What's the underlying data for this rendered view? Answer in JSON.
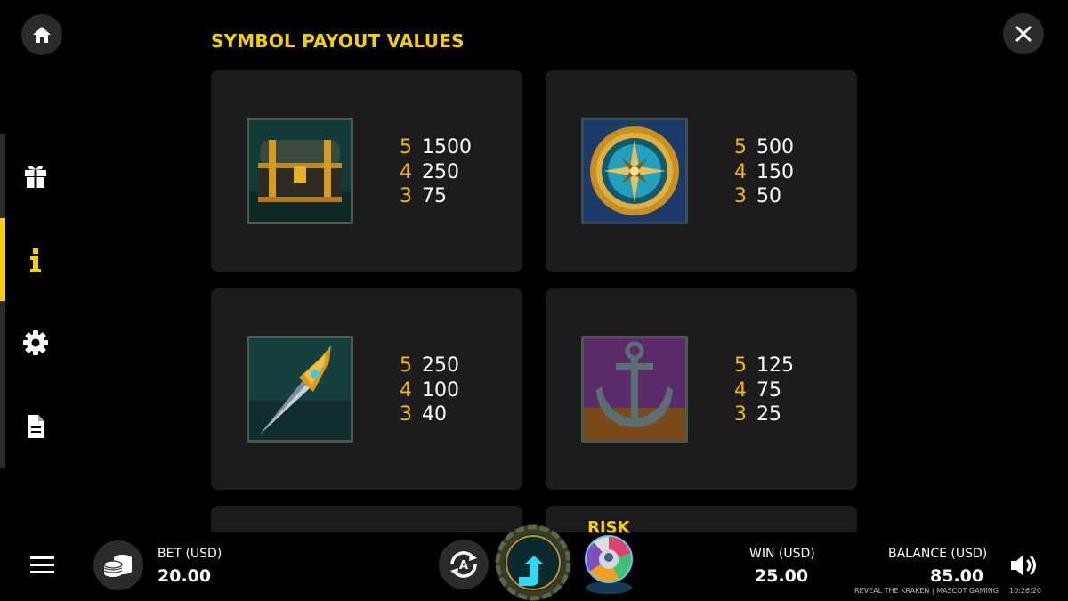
{
  "header": {
    "title": "SYMBOL PAYOUT VALUES",
    "home_icon": "home-icon",
    "close_icon": "close-icon"
  },
  "sidebar": {
    "items": [
      {
        "icon": "gift-icon",
        "active": false
      },
      {
        "icon": "info-icon",
        "active": true
      },
      {
        "icon": "gear-icon",
        "active": false
      },
      {
        "icon": "document-icon",
        "active": false
      }
    ],
    "active_color": "#f5d000"
  },
  "paytable": [
    {
      "symbol": "treasure-chest",
      "pays": [
        {
          "count": "5",
          "value": "1500"
        },
        {
          "count": "4",
          "value": "250"
        },
        {
          "count": "3",
          "value": "75"
        }
      ]
    },
    {
      "symbol": "compass",
      "pays": [
        {
          "count": "5",
          "value": "500"
        },
        {
          "count": "4",
          "value": "150"
        },
        {
          "count": "3",
          "value": "50"
        }
      ]
    },
    {
      "symbol": "dagger",
      "pays": [
        {
          "count": "5",
          "value": "250"
        },
        {
          "count": "4",
          "value": "100"
        },
        {
          "count": "3",
          "value": "40"
        }
      ]
    },
    {
      "symbol": "anchor",
      "pays": [
        {
          "count": "5",
          "value": "125"
        },
        {
          "count": "4",
          "value": "75"
        },
        {
          "count": "3",
          "value": "25"
        }
      ]
    }
  ],
  "bottom_bar": {
    "bet_label": "BET (USD)",
    "bet_value": "20.00",
    "win_label": "WIN (USD)",
    "win_value": "25.00",
    "balance_label": "BALANCE (USD)",
    "balance_value": "85.00",
    "risk_label": "RISK",
    "footer_game": "REVEAL THE KRAKEN | MASCOT GAMING",
    "footer_time": "10:26:20"
  },
  "colors": {
    "accent": "#f5d000",
    "pay_count": "#f5b800",
    "card_bg": "#1c1c1c",
    "background": "#000000"
  }
}
